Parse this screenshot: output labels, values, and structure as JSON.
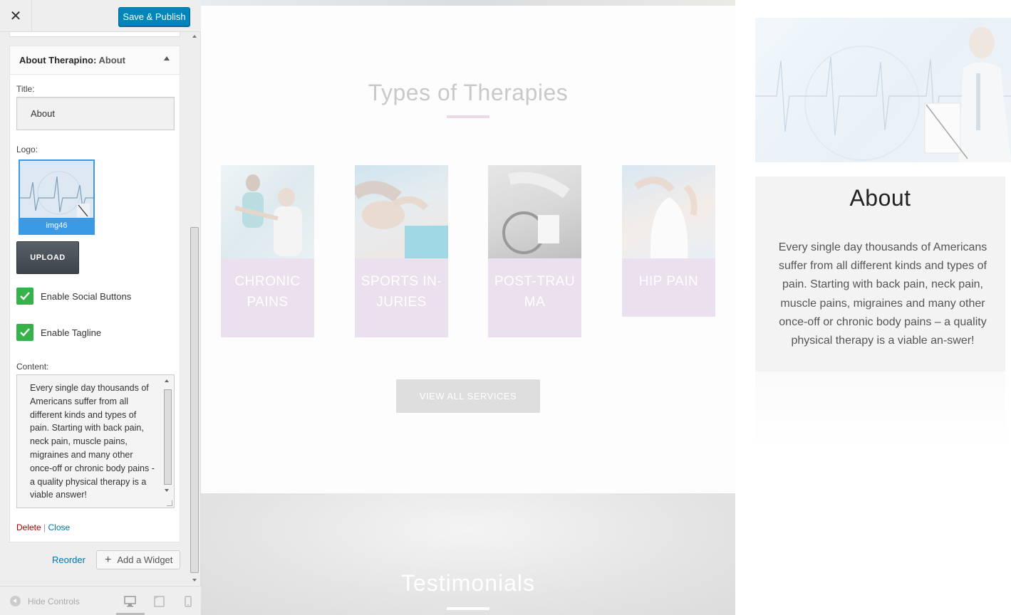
{
  "sidebar": {
    "close_icon": "close-icon",
    "save_label": "Save & Publish",
    "widget": {
      "title_prefix": "About Therapino:",
      "title_suffix": "About",
      "title_field_label": "Title:",
      "title_value": "About",
      "logo_label": "Logo:",
      "logo_caption": "img46",
      "upload_label": "UPLOAD",
      "social_label": "Enable Social Buttons",
      "social_checked": true,
      "tagline_label": "Enable Tagline",
      "tagline_checked": true,
      "content_label": "Content:",
      "content_value": "Every single day thousands of Americans suffer from all different kinds and types of pain. Starting with back pain, neck pain, muscle pains, migraines and many other once-off or chronic body pains - a quality physical therapy is a viable answer!",
      "delete_label": "Delete",
      "link_separator": "|",
      "close_label": "Close"
    },
    "reorder_label": "Reorder",
    "add_widget_label": "Add a Widget",
    "footer": {
      "hide_controls_label": "Hide Controls",
      "devices": [
        "desktop-icon",
        "tablet-icon",
        "mobile-icon"
      ],
      "active_device": "desktop"
    }
  },
  "preview": {
    "section_title": "Types of Therapies",
    "cards": [
      {
        "label": "CHRONIC PAINS"
      },
      {
        "label": "SPORTS IN-JURIES"
      },
      {
        "label": "POST-TRAU MA"
      },
      {
        "label": "HIP PAIN"
      }
    ],
    "view_all_label": "VIEW ALL SERVICES",
    "testimonials_title": "Testimonials",
    "about": {
      "title": "About",
      "text": "Every single day thousands of Americans suffer from all different kinds and types of pain. Starting with back pain, neck pain, muscle pains, migraines and many other once-off or chronic body pains – a quality physical therapy is a viable an-swer!"
    }
  },
  "colors": {
    "primary_button": "#0085ba",
    "checkbox": "#36b24a",
    "card_label_bg": "#ebe0ee",
    "accent_underline": "#ead9e7",
    "delete_link": "#aa0000",
    "link": "#0073aa"
  }
}
